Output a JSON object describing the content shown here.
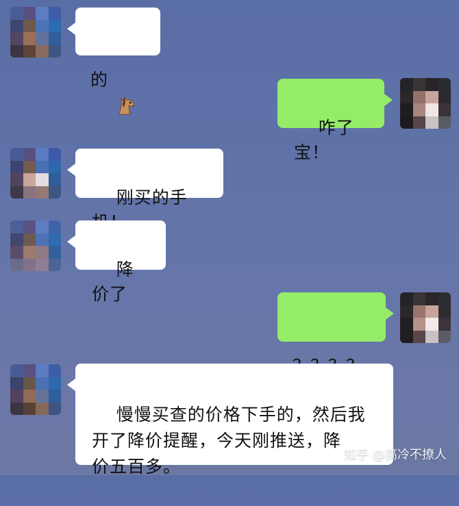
{
  "messages": [
    {
      "side": "left",
      "emoji": "horse-icon",
      "text": "的"
    },
    {
      "side": "right",
      "text": "咋了宝！"
    },
    {
      "side": "left",
      "text": "刚买的手机！"
    },
    {
      "side": "left",
      "text": "降价了"
    },
    {
      "side": "right",
      "text": "？？？？"
    },
    {
      "side": "left",
      "text": "慢慢买查的价格下手的，然后我\n开了降价提醒，今天刚推送，降\n价五百多。"
    }
  ],
  "watermark": "知乎 @高冷不撩人",
  "colors": {
    "background": "#5f72a8",
    "left_bubble": "#ffffff",
    "right_bubble": "#95ec69",
    "text": "#111111"
  }
}
